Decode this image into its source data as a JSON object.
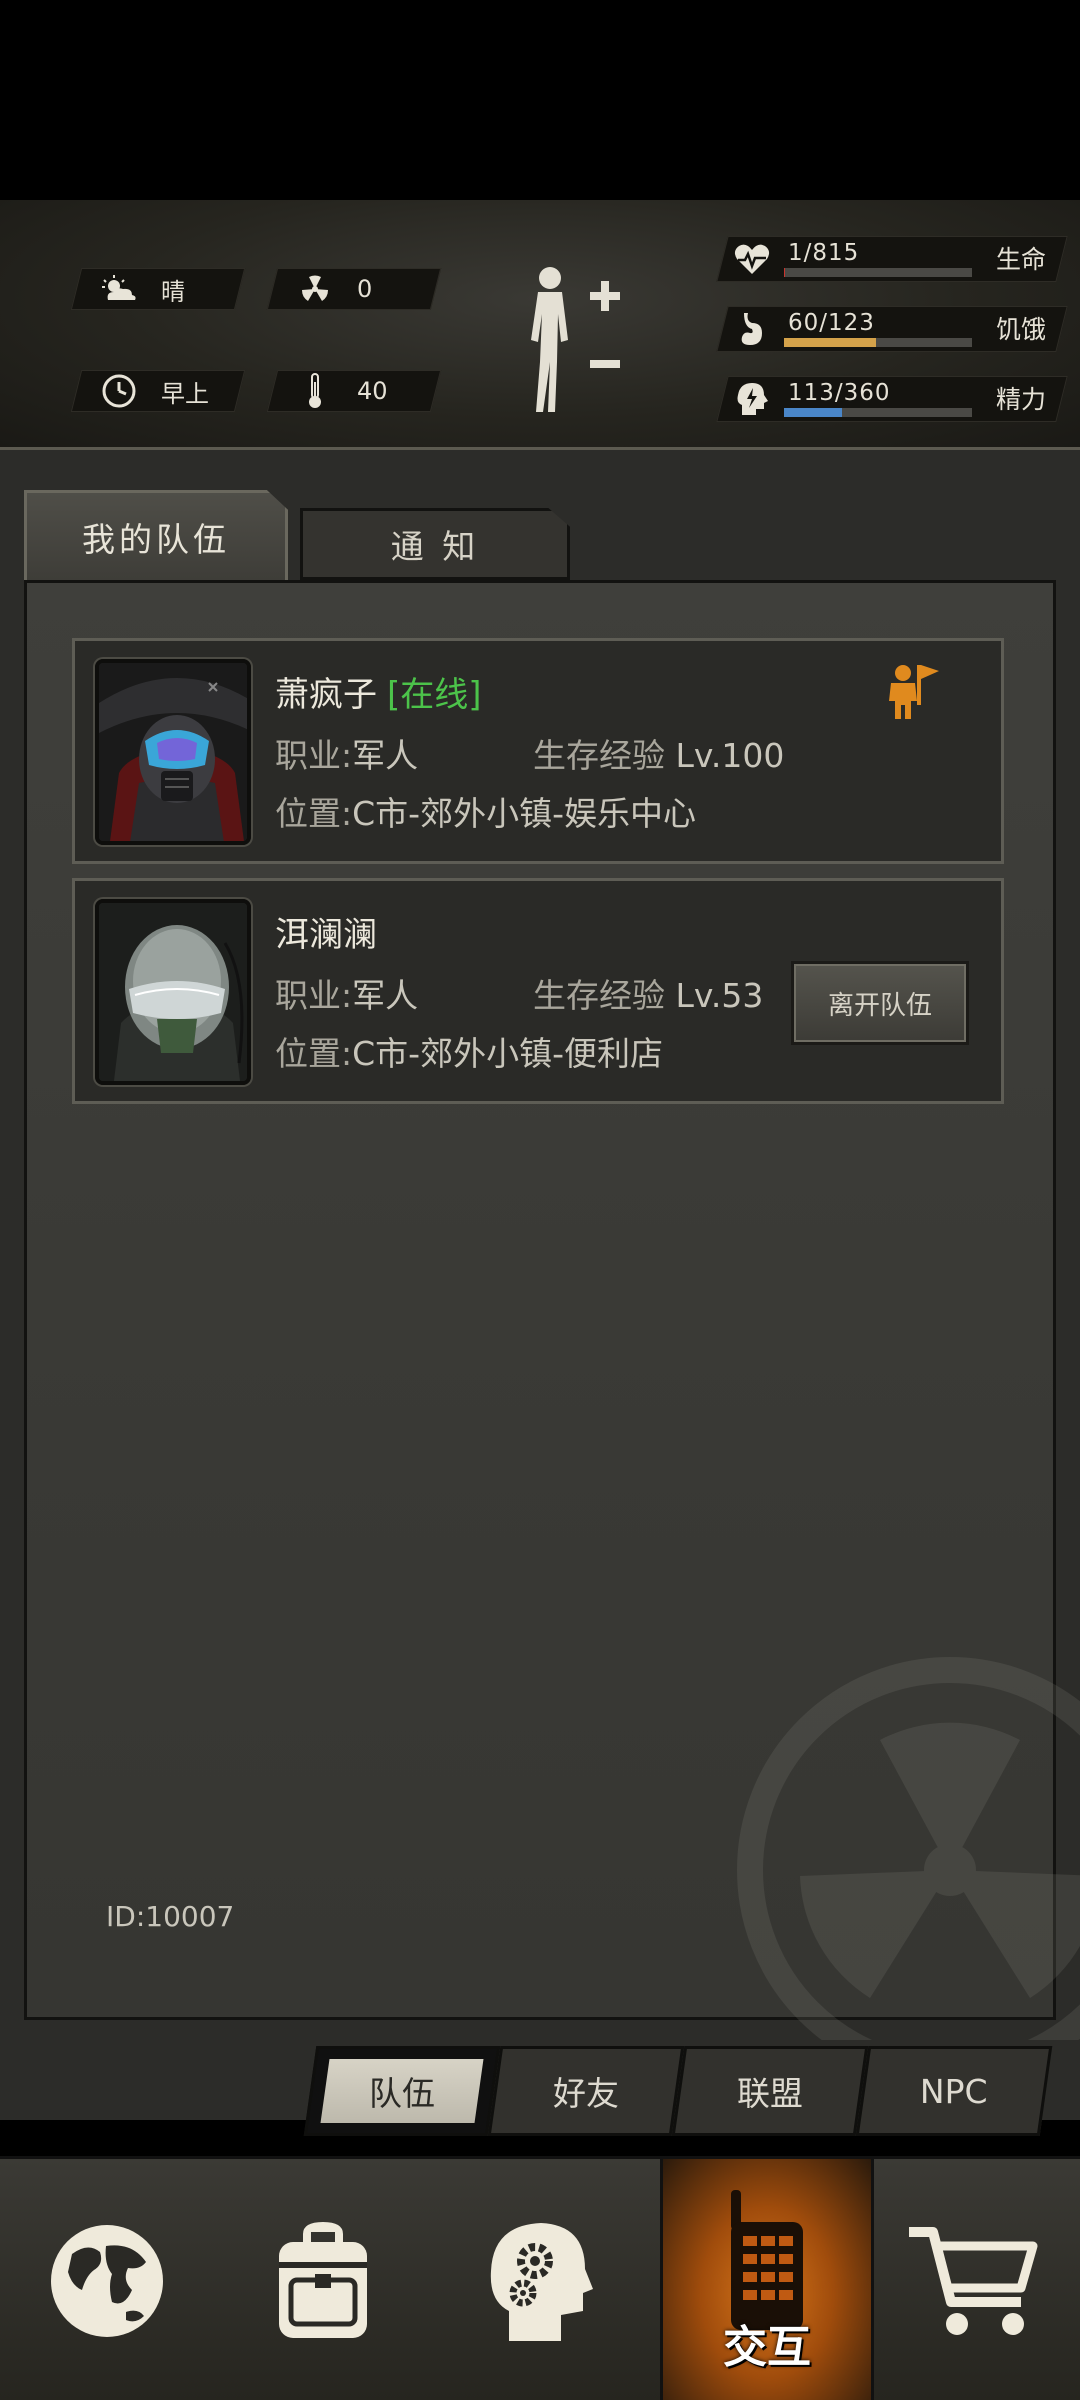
{
  "hud": {
    "weather": "晴",
    "radiation": "0",
    "time_of_day": "早上",
    "temperature": "40",
    "stats": [
      {
        "icon": "heart-icon",
        "value": "1/815",
        "label": "生命",
        "fraction": 0.0012,
        "color": "#c9342d"
      },
      {
        "icon": "stomach-icon",
        "value": "60/123",
        "label": "饥饿",
        "fraction": 0.49,
        "color": "#d4a24a"
      },
      {
        "icon": "energy-icon",
        "value": "113/360",
        "label": "精力",
        "fraction": 0.31,
        "color": "#4a86c8"
      }
    ]
  },
  "tabs": {
    "my_team": "我的队伍",
    "notice": "通 知"
  },
  "members": [
    {
      "name": "萧疯子",
      "status": "[在线]",
      "job_label": "职业:",
      "job": "军人",
      "exp_label": "生存经验",
      "level": "Lv.100",
      "loc_label": "位置:",
      "location": "C市-郊外小镇-娱乐中心"
    },
    {
      "name": "洱澜澜",
      "job_label": "职业:",
      "job": "军人",
      "exp_label": "生存经验",
      "level": "Lv.53",
      "loc_label": "位置:",
      "location": "C市-郊外小镇-便利店",
      "action": "离开队伍"
    }
  ],
  "player_id": "ID:10007",
  "subtabs": [
    "队伍",
    "好友",
    "联盟",
    "NPC"
  ],
  "bottom_nav": {
    "active_label": "交互"
  },
  "colors": {
    "online": "#4cc34a",
    "leader": "#e08a1e",
    "active_nav": "#d8761a"
  }
}
